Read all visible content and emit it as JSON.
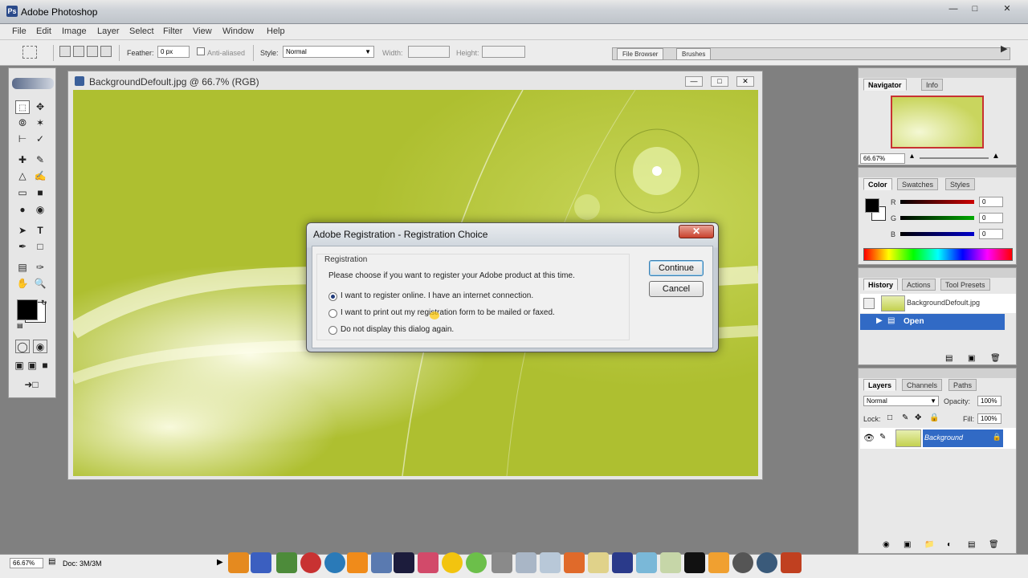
{
  "window": {
    "title": "Adobe Photoshop"
  },
  "menubar": {
    "items": [
      "File",
      "Edit",
      "Image",
      "Layer",
      "Select",
      "Filter",
      "View",
      "Window",
      "Help"
    ]
  },
  "options": {
    "feather_label": "Feather:",
    "feather_value": "0 px",
    "antialiased_label": "Anti-aliased",
    "style_label": "Style:",
    "style_value": "Normal",
    "width_label": "Width:",
    "height_label": "Height:",
    "palette_well": [
      "File Browser",
      "Brushes"
    ]
  },
  "document": {
    "title": "BackgroundDefoult.jpg @ 66.7% (RGB)"
  },
  "dialog": {
    "title": "Adobe Registration - Registration Choice",
    "group_label": "Registration",
    "prompt": "Please choose if you want to register your Adobe product at this time.",
    "options": [
      "I want to register online. I have an internet connection.",
      "I want to print out my registration form to be mailed or faxed.",
      "Do not display this dialog again."
    ],
    "selected_option": 0,
    "continue_label": "Continue",
    "cancel_label": "Cancel"
  },
  "navigator": {
    "tabs": [
      "Navigator",
      "Info"
    ],
    "zoom": "66.67%"
  },
  "color": {
    "tabs": [
      "Color",
      "Swatches",
      "Styles"
    ],
    "channels": [
      {
        "label": "R",
        "value": "0",
        "color": "#cc0000"
      },
      {
        "label": "G",
        "value": "0",
        "color": "#00aa00"
      },
      {
        "label": "B",
        "value": "0",
        "color": "#0000cc"
      }
    ]
  },
  "history": {
    "tabs": [
      "History",
      "Actions",
      "Tool Presets"
    ],
    "snapshot": "BackgroundDefoult.jpg",
    "items": [
      "Open"
    ]
  },
  "layers": {
    "tabs": [
      "Layers",
      "Channels",
      "Paths"
    ],
    "blend_mode": "Normal",
    "opacity_label": "Opacity:",
    "opacity": "100%",
    "lock_label": "Lock:",
    "fill_label": "Fill:",
    "fill": "100%",
    "layer_name": "Background"
  },
  "status": {
    "zoom": "66.67%",
    "doc": "Doc: 3M/3M"
  },
  "colors": {
    "accent": "#316ac5",
    "dialog_close": "#c9412c"
  }
}
